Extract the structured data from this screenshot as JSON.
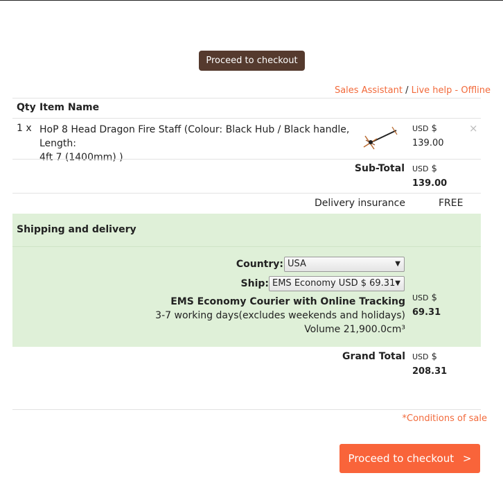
{
  "checkout_top": {
    "label": "Proceed to checkout"
  },
  "help": {
    "sales_assistant": "Sales Assistant",
    "separator": "/",
    "live_help": "Live help - Offline"
  },
  "table": {
    "headers": {
      "qty": "Qty",
      "item": "Item Name"
    },
    "items": [
      {
        "qty": "1 x",
        "name_line1": "HoP 8 Head Dragon Fire Staff (Colour: Black Hub / Black handle, Length:",
        "name_line2": "4ft 7 (1400mm) )",
        "currency": "USD",
        "currency_symbol": "$",
        "price": "139.00",
        "remove": "×",
        "image": "fire-staff-icon"
      }
    ]
  },
  "subtotal": {
    "label": "Sub-Total",
    "currency": "USD",
    "currency_symbol": "$",
    "value": "139.00"
  },
  "insurance": {
    "label": "Delivery insurance",
    "value": "FREE"
  },
  "shipping": {
    "heading": "Shipping and delivery",
    "country_label": "Country:",
    "country_value": "USA",
    "ship_label": "Ship:",
    "ship_value": "EMS Economy USD $ 69.31",
    "method": "EMS Economy Courier with Online Tracking",
    "days": "3-7 working days(excludes weekends and holidays)",
    "volume": "Volume 21,900.0cm³",
    "currency": "USD",
    "currency_symbol": "$",
    "cost": "69.31"
  },
  "grand_total": {
    "label": "Grand Total",
    "currency": "USD",
    "currency_symbol": "$",
    "value": "208.31"
  },
  "conditions": "*Conditions of sale",
  "checkout_bottom": {
    "label": "Proceed to checkout",
    "arrow": ">"
  },
  "colors": {
    "accent": "#f26a3b",
    "button_top": "#553a2e",
    "button_bottom": "#f9643a",
    "shipping_bg": "#dff0d8"
  }
}
